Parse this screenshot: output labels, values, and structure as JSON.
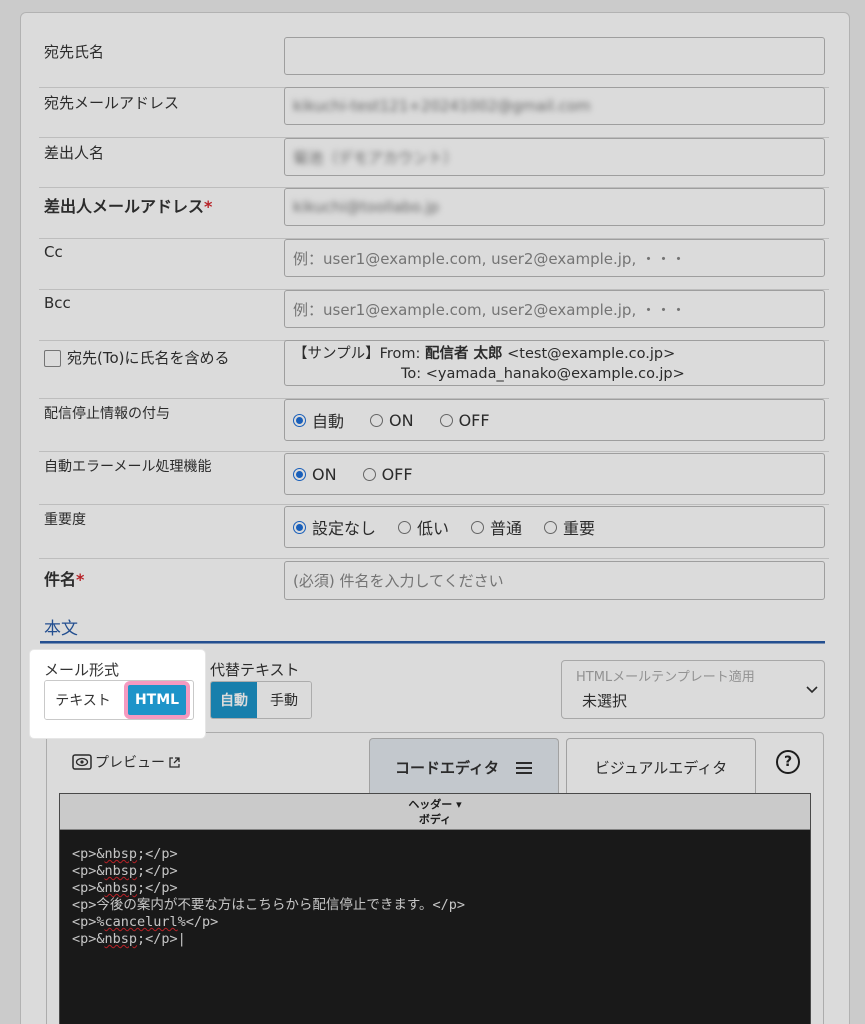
{
  "form": {
    "recipient_name": {
      "label": "宛先氏名",
      "value": ""
    },
    "recipient_email": {
      "label": "宛先メールアドレス",
      "value": "kikuchi-test121+20241002@gmail.com"
    },
    "sender_name": {
      "label": "差出人名",
      "value": "菊池（デモアカウント）"
    },
    "sender_email": {
      "label": "差出人メールアドレス",
      "required_mark": "*",
      "value": "kikuchi@toollabo.jp"
    },
    "cc": {
      "label": "Cc",
      "placeholder": "例：user1@example.com, user2@example.jp, ・・・"
    },
    "bcc": {
      "label": "Bcc",
      "placeholder": "例：user1@example.com, user2@example.jp, ・・・"
    },
    "include_name": {
      "label": "宛先(To)に氏名を含める",
      "sample_prefix": "【サンプル】From:",
      "sample_from_name": "配信者 太郎",
      "sample_from_addr": "<test@example.co.jp>",
      "sample_to": "To: <yamada_hanako@example.co.jp>"
    },
    "unsubscribe_info": {
      "label": "配信停止情報の付与",
      "options": [
        "自動",
        "ON",
        "OFF"
      ],
      "selected": "自動"
    },
    "auto_error": {
      "label": "自動エラーメール処理機能",
      "options": [
        "ON",
        "OFF"
      ],
      "selected": "ON"
    },
    "priority": {
      "label": "重要度",
      "options": [
        "設定なし",
        "低い",
        "普通",
        "重要"
      ],
      "selected": "設定なし"
    },
    "subject": {
      "label": "件名",
      "required_mark": "*",
      "placeholder": "(必須) 件名を入力してください"
    }
  },
  "body_section": {
    "title": "本文",
    "mail_format": {
      "label": "メール形式",
      "options": [
        "テキスト",
        "HTML"
      ],
      "selected": "HTML"
    },
    "alt_text": {
      "label": "代替テキスト",
      "options": [
        "自動",
        "手動"
      ],
      "selected": "自動"
    },
    "template": {
      "label": "HTMLメールテンプレート適用",
      "value": "未選択"
    }
  },
  "editor": {
    "preview_label": "プレビュー",
    "tabs": [
      "コードエディタ",
      "ビジュアルエディタ"
    ],
    "active_tab": "コードエディタ",
    "help": "?",
    "header_dropdown": "ヘッダー ▾",
    "body_label": "ボディ",
    "code_lines": [
      "<p>&nbsp;</p>",
      "<p>&nbsp;</p>",
      "<p>&nbsp;</p>",
      "<p>今後の案内が不要な方はこちらから配信停止できます。</p>",
      "<p>%cancelurl%</p>",
      "<p>&nbsp;</p>"
    ]
  },
  "colors": {
    "accent": "#1d94c9",
    "highlight": "#f59ac0",
    "required": "#d6272d",
    "section_line": "#2a5da8"
  }
}
